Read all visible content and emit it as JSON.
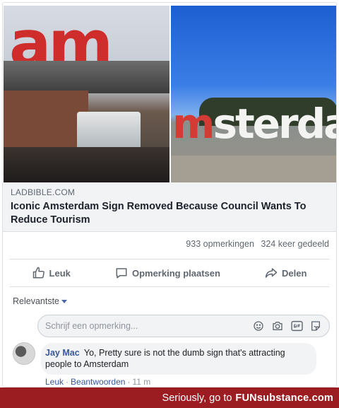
{
  "post": {
    "image": {
      "left_sign_text": "am",
      "right_sign_red": "m",
      "right_sign_text": "sterdar"
    },
    "source": "LADBIBLE.COM",
    "headline": "Iconic Amsterdam Sign Removed Because Council Wants To Reduce Tourism"
  },
  "stats": {
    "comments": "933 opmerkingen",
    "shares": "324 keer gedeeld"
  },
  "actions": {
    "like": "Leuk",
    "comment": "Opmerking plaatsen",
    "share": "Delen"
  },
  "comments": {
    "sort_label": "Relevantste",
    "composer_placeholder": "Schrijf een opmerking...",
    "items": [
      {
        "author": "Jay Mac",
        "text": "Yo, Pretty sure is not the dumb sign that's attracting people to Amsterdam",
        "like": "Leuk",
        "reply": "Beantwoorden",
        "time": "11 m"
      }
    ]
  },
  "footer": {
    "text": "Seriously, go to",
    "brand": "FUNsubstance.com"
  },
  "colors": {
    "link": "#385898",
    "footer_bg": "#9b1d22",
    "sign_red": "#cf2c2c"
  },
  "icons": [
    "thumbs-up-icon",
    "comment-icon",
    "share-icon",
    "emoji-icon",
    "camera-icon",
    "gif-icon",
    "sticker-icon"
  ]
}
